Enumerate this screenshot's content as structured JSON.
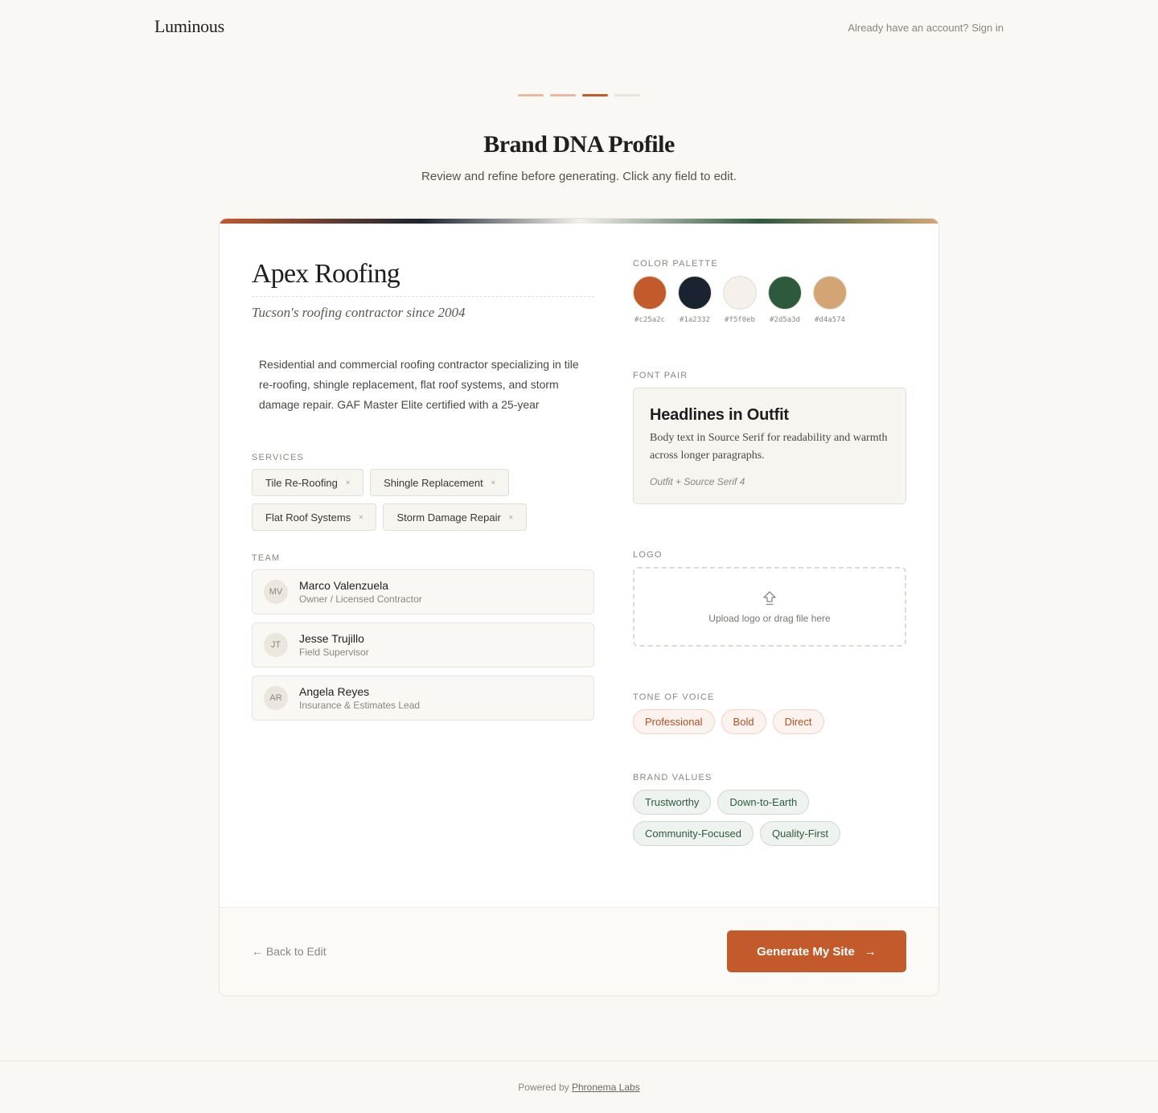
{
  "header": {
    "logo": "Luminous",
    "signin_link": "Already have an account? Sign in"
  },
  "progress": {
    "total_steps": 4,
    "current_step": 3
  },
  "page": {
    "title": "Brand DNA Profile",
    "subtitle": "Review and refine before generating. Click any field to edit."
  },
  "profile": {
    "business_name": "Apex Roofing",
    "tagline": "Tucson's roofing contractor since 2004",
    "description": "Residential and commercial roofing contractor specializing in tile re-roofing, shingle replacement, flat roof systems, and storm damage repair. GAF Master Elite certified with a 25-year"
  },
  "services": {
    "label": "SERVICES",
    "items": [
      "Tile Re-Roofing",
      "Shingle Replacement",
      "Flat Roof Systems",
      "Storm Damage Repair"
    ],
    "remove_glyph": "×"
  },
  "team": {
    "label": "TEAM",
    "members": [
      {
        "initials": "MV",
        "name": "Marco Valenzuela",
        "role": "Owner / Licensed Contractor"
      },
      {
        "initials": "JT",
        "name": "Jesse Trujillo",
        "role": "Field Supervisor"
      },
      {
        "initials": "AR",
        "name": "Angela Reyes",
        "role": "Insurance & Estimates Lead"
      }
    ]
  },
  "palette": {
    "label": "COLOR PALETTE",
    "colors": [
      "#c25a2c",
      "#1a2332",
      "#f5f0eb",
      "#2d5a3d",
      "#d4a574"
    ]
  },
  "font_pair": {
    "label": "FONT PAIR",
    "headline": "Headlines in Outfit",
    "body": "Body text in Source Serif for readability and warmth across longer paragraphs.",
    "meta": "Outfit + Source Serif 4"
  },
  "logo_upload": {
    "label": "LOGO",
    "icon": "upload-icon",
    "text": "Upload logo or drag file here"
  },
  "tone": {
    "label": "TONE OF VOICE",
    "items": [
      "Professional",
      "Bold",
      "Direct"
    ]
  },
  "values": {
    "label": "BRAND VALUES",
    "items": [
      "Trustworthy",
      "Down-to-Earth",
      "Community-Focused",
      "Quality-First"
    ]
  },
  "actions": {
    "back_label": "← Back to Edit",
    "generate_label": "Generate My Site",
    "generate_arrow": "→"
  },
  "footer": {
    "prefix": "Powered by ",
    "link": "Phronema Labs"
  },
  "colors": {
    "accent": "#c25a2c",
    "background": "#f9f8f4",
    "value_green": "#2d5a3d"
  }
}
